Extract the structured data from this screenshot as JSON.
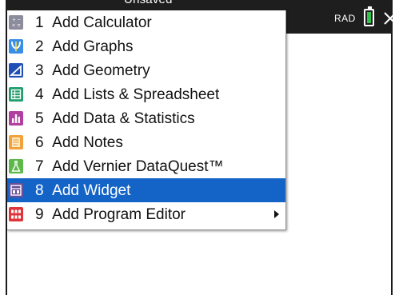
{
  "top_bar": {
    "title_fragment": "*Unsaved",
    "angle_mode": "RAD",
    "battery_icon": "battery-icon",
    "close_icon": "close-icon"
  },
  "menu": {
    "items": [
      {
        "number": "1",
        "label": "Add Calculator",
        "icon": "calculator-icon",
        "icon_color": "#8c8c9c",
        "selected": false,
        "has_submenu": false
      },
      {
        "number": "2",
        "label": "Add Graphs",
        "icon": "graphs-icon",
        "icon_color": "#3a8ee6",
        "selected": false,
        "has_submenu": false
      },
      {
        "number": "3",
        "label": "Add Geometry",
        "icon": "geometry-icon",
        "icon_color": "#1f4fb4",
        "selected": false,
        "has_submenu": false
      },
      {
        "number": "4",
        "label": "Add Lists & Spreadsheet",
        "icon": "spreadsheet-icon",
        "icon_color": "#1f9d6b",
        "selected": false,
        "has_submenu": false
      },
      {
        "number": "5",
        "label": "Add Data & Statistics",
        "icon": "statistics-icon",
        "icon_color": "#b03fa0",
        "selected": false,
        "has_submenu": false
      },
      {
        "number": "6",
        "label": "Add Notes",
        "icon": "notes-icon",
        "icon_color": "#f2a23a",
        "selected": false,
        "has_submenu": false
      },
      {
        "number": "7",
        "label": "Add Vernier DataQuest™",
        "icon": "dataquest-icon",
        "icon_color": "#5cb94a",
        "selected": false,
        "has_submenu": false
      },
      {
        "number": "8",
        "label": "Add Widget",
        "icon": "widget-icon",
        "icon_color": "#6a4f9a",
        "selected": true,
        "has_submenu": false
      },
      {
        "number": "9",
        "label": "Add Program Editor",
        "icon": "program-editor-icon",
        "icon_color": "#e0343a",
        "selected": false,
        "has_submenu": true
      }
    ]
  }
}
